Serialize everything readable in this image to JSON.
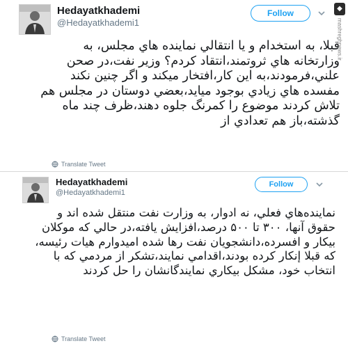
{
  "tweets": [
    {
      "name": "Hedayatkhademi",
      "handle": "@Hedayatkhademi1",
      "follow_label": "Follow",
      "body": "قبلا، به استخدام و يا انتقالي نماينده هاي مجلس، به وزارتخانه هاي ثروتمند،انتقاد كردم؟ وزير نفت،در صحن علني،فرمودند،به اين كار،افتخار ميكند و اگر چنين نكند مفسده هاي زيادي بوجود ميايد،بعضي دوستان در مجلس هم تلاش كردند موضوع را كمرنگ جلوه دهند،ظرف چند ماه گذشته،باز هم تعدادي از",
      "translate_label": "Translate Tweet"
    },
    {
      "name": "Hedayatkhademi",
      "handle": "@Hedayatkhademi1",
      "follow_label": "Follow",
      "body": "نماينده‌هاي فعلي، نه ادوار، به وزارت نفت منتقل شده اند و حقوق آنها، ۳۰۰ تا ۵۰۰ درصد،افزايش يافته،در حالي كه موكلان بيكار و افسرده،دانشجويان نفت رها شده اميدوارم هيات رئيسه، كه قبلا إنكار كرده بودند،اقدامي نمايند،تشكر از مردمي كه با انتخاب خود، مشكل بيكاري نمايندگانشان را حل كردند",
      "translate_label": "Translate Tweet"
    }
  ],
  "watermark": {
    "text": "mashreghnews.ir"
  },
  "colors": {
    "accent": "#1da1f2",
    "text": "#14171a",
    "muted": "#657786"
  },
  "icons": {
    "menu": "chevron-down-icon",
    "translate": "globe-icon",
    "avatar": "avatar"
  }
}
